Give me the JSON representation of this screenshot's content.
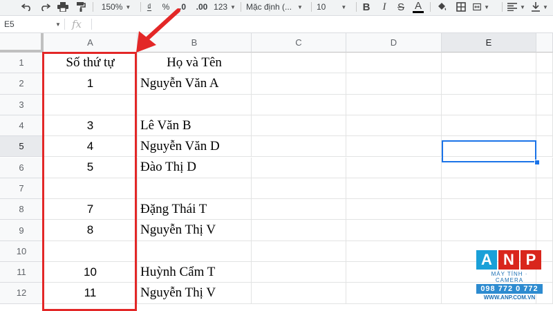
{
  "toolbar": {
    "zoom": "150%",
    "currency": "₫",
    "percent": "%",
    "decimal_decrease": ".0",
    "decimal_increase": ".00",
    "more_formats": "123",
    "font": "Mặc định (...",
    "font_size": "10",
    "bold": "B",
    "italic": "I",
    "strike": "S",
    "text_color": "A"
  },
  "formula_bar": {
    "name_box": "E5",
    "fx": "fx",
    "value": ""
  },
  "columns": [
    "A",
    "B",
    "C",
    "D",
    "E"
  ],
  "selected_column": "E",
  "selected_row": "5",
  "rows": [
    {
      "num": "1",
      "a": "Số thứ tự",
      "b": "Họ và Tên"
    },
    {
      "num": "2",
      "a": "1",
      "b": "Nguyễn Văn A"
    },
    {
      "num": "3",
      "a": "",
      "b": ""
    },
    {
      "num": "4",
      "a": "3",
      "b": "Lê Văn B"
    },
    {
      "num": "5",
      "a": "4",
      "b": "Nguyễn Văn D"
    },
    {
      "num": "6",
      "a": "5",
      "b": "Đào Thị D"
    },
    {
      "num": "7",
      "a": "",
      "b": ""
    },
    {
      "num": "8",
      "a": "7",
      "b": "Đặng Thái T"
    },
    {
      "num": "9",
      "a": "8",
      "b": "Nguyễn Thị V"
    },
    {
      "num": "10",
      "a": "",
      "b": ""
    },
    {
      "num": "11",
      "a": "10",
      "b": "Huỳnh Cẩm T"
    },
    {
      "num": "12",
      "a": "11",
      "b": "Nguyễn Thị V"
    }
  ],
  "colors": {
    "highlight": "#e32727",
    "selection": "#1a73e8"
  },
  "logo": {
    "letters": [
      "A",
      "N",
      "P"
    ],
    "tagline": "MÁY TÍNH · CAMERA",
    "phone": "098 772 0 772",
    "website": "WWW.ANP.COM.VN"
  }
}
